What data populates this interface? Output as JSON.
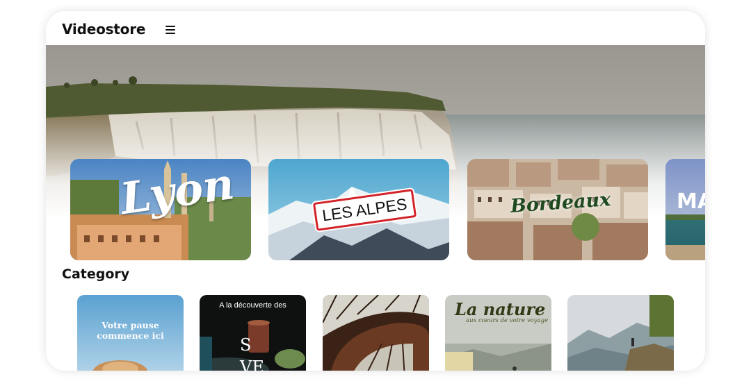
{
  "app": {
    "title": "Videostore",
    "menu_icon": "hamburger-menu-icon"
  },
  "hero": {
    "image": "coastal-white-cliffs-photo"
  },
  "destinations": [
    {
      "label": "Lyon"
    },
    {
      "label": "LES ALPES"
    },
    {
      "label": "Bordeaux"
    },
    {
      "label": "MA"
    }
  ],
  "category_section": {
    "title": "Category"
  },
  "categories": [
    {
      "text": "Votre pause commence ici"
    },
    {
      "text": "A la découverte des"
    },
    {
      "text": ""
    },
    {
      "text": "La nature",
      "subtitle": "aux coeurs de votre voyage"
    },
    {
      "text": ""
    }
  ],
  "colors": {
    "brand_text": "#111111",
    "alpes_badge_border": "#d2232a",
    "bordeaux_text": "#1f4a1f"
  }
}
